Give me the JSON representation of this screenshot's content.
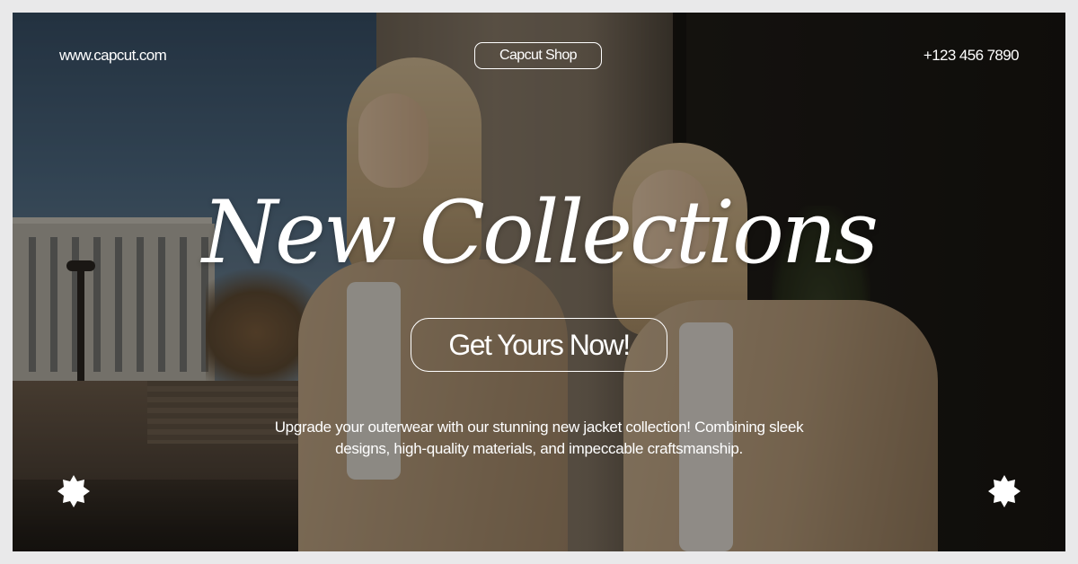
{
  "header": {
    "website": "www.capcut.com",
    "shop_name": "Capcut Shop",
    "phone": "+123 456 7890"
  },
  "hero": {
    "headline": "New Collections",
    "cta_label": "Get Yours Now!",
    "description": "Upgrade your outerwear with our stunning new jacket collection! Combining sleek designs, high-quality materials, and impeccable craftsmanship."
  },
  "decorations": {
    "left_icon": "starburst-icon",
    "right_icon": "starburst-icon"
  },
  "colors": {
    "text": "#ffffff",
    "page_border": "#e9e9ea",
    "coat": "#c8ad8d"
  }
}
